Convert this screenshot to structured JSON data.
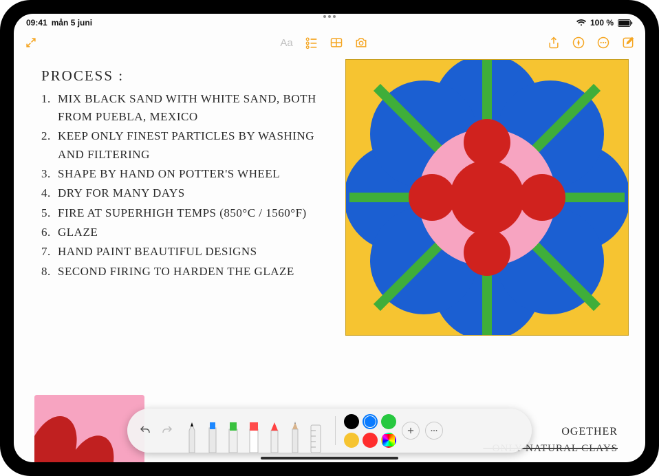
{
  "status_bar": {
    "time": "09:41",
    "date": "mån 5 juni",
    "wifi_icon": "wifi",
    "battery_label": "100 %"
  },
  "toolbar": {
    "collapse_icon": "collapse",
    "text_style_label": "Aa",
    "checklist_icon": "checklist",
    "table_icon": "table",
    "camera_icon": "camera",
    "share_icon": "share",
    "apple_pen_icon": "apple-pencil",
    "more_icon": "more",
    "compose_icon": "compose"
  },
  "note": {
    "title": "PROCESS :",
    "items": [
      "MIX BLACK SAND WITH WHITE SAND, BOTH FROM PUEBLA, MEXICO",
      "KEEP ONLY FINEST PARTICLES BY WASHING  AND FILTERING",
      "SHAPE BY HAND ON POTTER'S WHEEL",
      "DRY FOR MANY DAYS",
      "FIRE AT SUPERHIGH TEMPS (850°C / 1560°F)",
      "GLAZE",
      "HAND PAINT BEAUTIFUL DESIGNS",
      "SECOND FIRING TO HARDEN THE GLAZE"
    ],
    "bottom_text1": "OGETHER",
    "bottom_text2": "– ONLY NATURAL CLAYS"
  },
  "drawing": {
    "bg": "#f6c431",
    "petal": "#1b5fd2",
    "stem": "#3fae3a",
    "inner_circle": "#f7a4c1",
    "center": "#d0221e"
  },
  "markup": {
    "undo_icon": "undo",
    "redo_icon": "redo",
    "tools": [
      {
        "name": "pen",
        "tip": "#000000"
      },
      {
        "name": "marker",
        "tip": "#1e88ff"
      },
      {
        "name": "highlighter",
        "tip": "#3ac13f"
      },
      {
        "name": "eraser",
        "tip": "#ff4a4a"
      },
      {
        "name": "lasso",
        "tip": "#ff4242"
      },
      {
        "name": "pencil",
        "tip": "#888888"
      },
      {
        "name": "ruler",
        "tip": "#cccccc"
      }
    ],
    "swatches": [
      {
        "name": "black",
        "color": "#000000",
        "selected": false
      },
      {
        "name": "blue",
        "color": "#0a7bff",
        "selected": true
      },
      {
        "name": "green",
        "color": "#27c840",
        "selected": false
      },
      {
        "name": "yellow",
        "color": "#f6c431",
        "selected": false
      },
      {
        "name": "red",
        "color": "#ff2d2d",
        "selected": false
      },
      {
        "name": "rainbow",
        "color": "rainbow",
        "selected": false
      }
    ],
    "add_icon": "add",
    "more_icon": "more"
  }
}
